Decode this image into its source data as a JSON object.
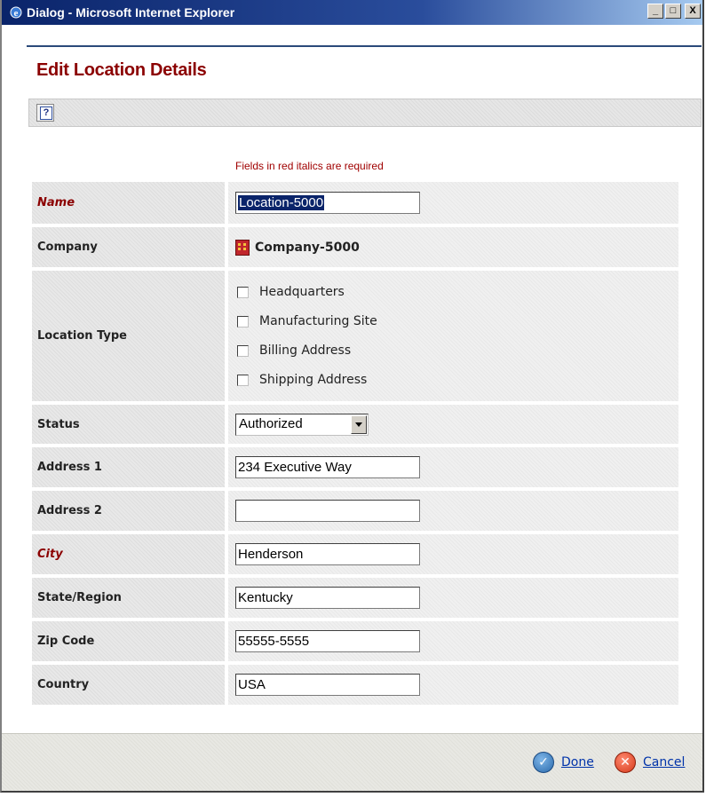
{
  "window": {
    "title": "Dialog - Microsoft Internet Explorer",
    "controls": [
      "_",
      "□",
      "X"
    ]
  },
  "page": {
    "heading": "Edit Location Details",
    "toolbar_help_icon": "help-icon",
    "required_note": "Fields in red italics are required"
  },
  "form": {
    "name": {
      "label": "Name",
      "value": "Location-5000",
      "required": true
    },
    "company": {
      "label": "Company",
      "value": "Company-5000",
      "icon": "building-icon"
    },
    "location_type": {
      "label": "Location Type",
      "options": [
        {
          "label": "Headquarters",
          "checked": false
        },
        {
          "label": "Manufacturing Site",
          "checked": false
        },
        {
          "label": "Billing Address",
          "checked": false
        },
        {
          "label": "Shipping Address",
          "checked": false
        }
      ]
    },
    "status": {
      "label": "Status",
      "value": "Authorized"
    },
    "address1": {
      "label": "Address 1",
      "value": "234 Executive Way"
    },
    "address2": {
      "label": "Address 2",
      "value": ""
    },
    "city": {
      "label": "City",
      "value": "Henderson",
      "required": true
    },
    "state": {
      "label": "State/Region",
      "value": "Kentucky"
    },
    "zip": {
      "label": "Zip Code",
      "value": "55555-5555"
    },
    "country": {
      "label": "Country",
      "value": "USA"
    }
  },
  "footer": {
    "done_label": "Done",
    "cancel_label": "Cancel"
  },
  "colors": {
    "required": "#8b0000",
    "link": "#0033aa",
    "titlebar": "#0a246a"
  }
}
